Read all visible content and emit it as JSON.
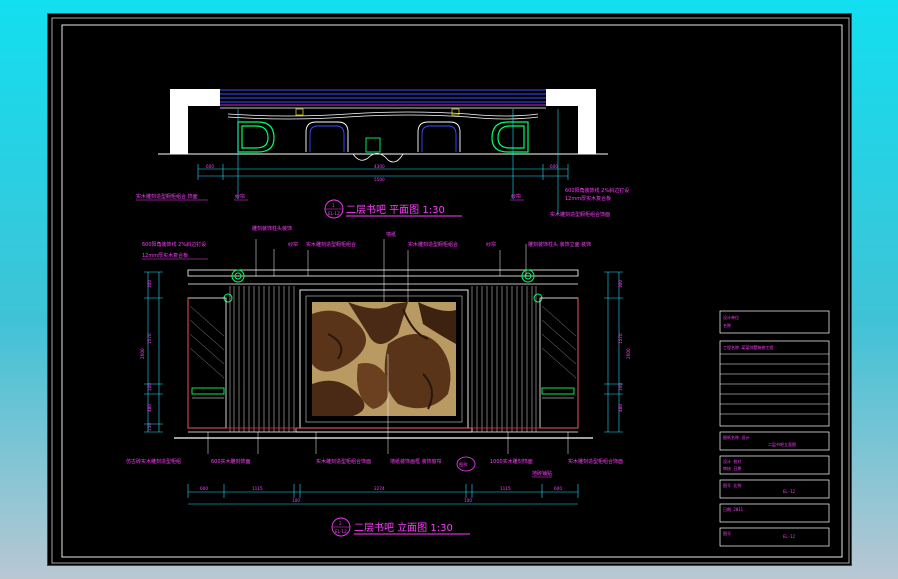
{
  "plan_view": {
    "title": "二层书吧 平面图 1:30",
    "symbol_number": "1",
    "symbol_sheet": "EL-12",
    "labels": {
      "left_cabinet": "实木雕刻造型橱柜组合 饰面",
      "curtain_left": "纱帘",
      "curtain_right": "纱帘",
      "right_top": "600阳角装饰线 2%斜边钉设",
      "right_mid": "12mm厚实木复合板",
      "right_bottom": "实木雕刻造型橱柜组合饰面"
    },
    "dims": [
      "600",
      "4300",
      "600"
    ],
    "total": "5500"
  },
  "elevation_view": {
    "title": "二层书吧 立面图 1:30",
    "symbol_number": "2",
    "symbol_sheet": "EL-12",
    "labels": {
      "top_a": "雕刻装饰柱头装饰",
      "top_b": "纱帘",
      "top_c": "实木雕刻造型橱柜组合",
      "top_d": "墙纸",
      "top_e": "实木雕刻造型橱柜组合",
      "top_f": "纱帘",
      "top_g": "雕刻装饰柱头 装饰立面 装饰",
      "left_1": "600阳角装饰线 2%斜边钉设",
      "left_2": "12mm厚实木复合板",
      "bottom_a": "仿古砖实木雕刻造型柜组",
      "bottom_b": "600实木雕刻饰面",
      "bottom_c": "实木雕刻造型柜组合饰面",
      "bottom_d": "墙纸装饰画框 装饰窗帘",
      "bottom_e": "1000实木雕刻饰面",
      "bottom_f": "实木雕刻造型柜组合饰面",
      "bottom_g": "地砖铺贴",
      "circle_label": "图例"
    },
    "h_dims": [
      "600",
      "1115",
      "100",
      "2274",
      "100",
      "1115",
      "600"
    ],
    "v_dims_left": [
      "300",
      "1570",
      "100",
      "480",
      "150"
    ],
    "v_dims_left_total": "2600",
    "v_dims_right": [
      "300",
      "1570",
      "100",
      "480"
    ],
    "v_dims_right_total": "2600"
  },
  "title_block": {
    "rows": [
      {
        "line1": "设计单位",
        "line2": "名称"
      },
      {
        "line1": "工程名称 某某别墅装修工程",
        "line2": ""
      },
      {
        "line1": "图纸名称 设计",
        "line2": "二层书吧立面图"
      },
      {
        "line1": "设计 校对",
        "line2": "审核  日期"
      },
      {
        "line1": "图号 比例",
        "line2": "EL-12"
      },
      {
        "line1": "日期 2011",
        "line2": ""
      },
      {
        "line1": "图号",
        "line2": "EL-12"
      }
    ]
  },
  "colors": {
    "background_top": "#12dff0",
    "sheet": "#000000",
    "magenta": "#ff3cff",
    "cyan": "#22e0ff",
    "green": "#00ff66",
    "blue": "#3a4cff",
    "white": "#ffffff",
    "red": "#ff3030"
  }
}
